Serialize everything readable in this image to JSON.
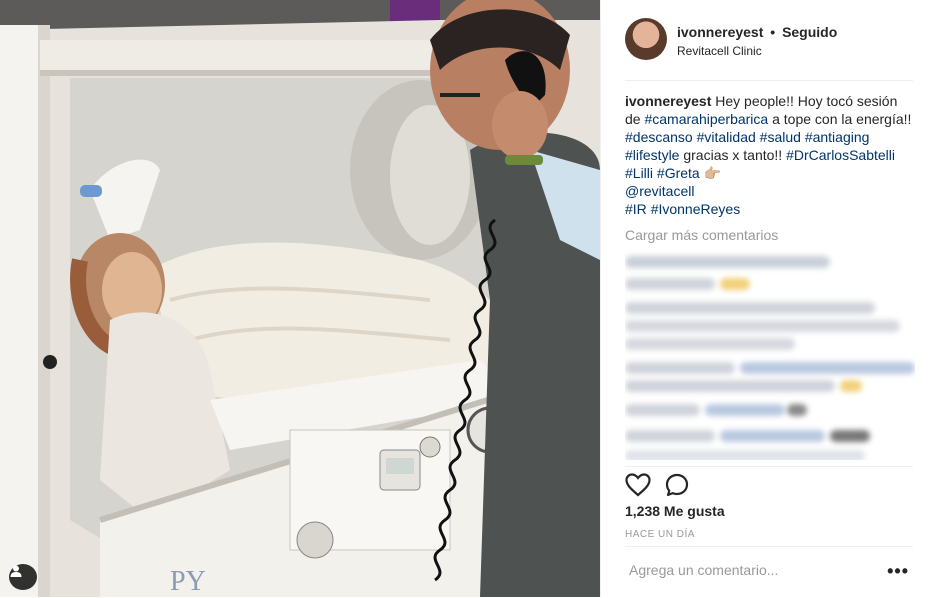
{
  "header": {
    "username": "ivonnereyest",
    "separator": "•",
    "follow_status": "Seguido",
    "location": "Revitacell Clinic"
  },
  "caption": {
    "username": "ivonnereyest",
    "text_1": "Hey people!! Hoy tocó sesión de",
    "tag_1": "#camarahiperbarica",
    "text_2": "a tope con la energía!!",
    "tag_2": "#descanso",
    "tag_3": "#vitalidad",
    "tag_4": "#salud",
    "tag_5": "#antiaging",
    "tag_6": "#lifestyle",
    "text_3": "gracias x tanto!!",
    "tag_7": "#DrCarlosSabtelli",
    "tag_8": "#Lilli",
    "tag_9": "#Greta",
    "emoji": "👉🏼",
    "tag_10": "@revitacell",
    "tag_11": "#IR",
    "tag_12": "#IvonneReyes"
  },
  "comments": {
    "load_more": "Cargar más comentarios"
  },
  "actions": {
    "likes": "1,238 Me gusta",
    "timestamp": "HACE UN DÍA"
  },
  "add_comment": {
    "placeholder": "Agrega un comentario...",
    "more": "•••"
  },
  "icons": {
    "like": "heart-icon",
    "comment": "comment-icon",
    "tag": "user-tag-icon",
    "options": "more-options-icon"
  },
  "colors": {
    "hashtag": "#003569",
    "muted": "#999999",
    "text": "#262626",
    "divider": "#efefef"
  }
}
